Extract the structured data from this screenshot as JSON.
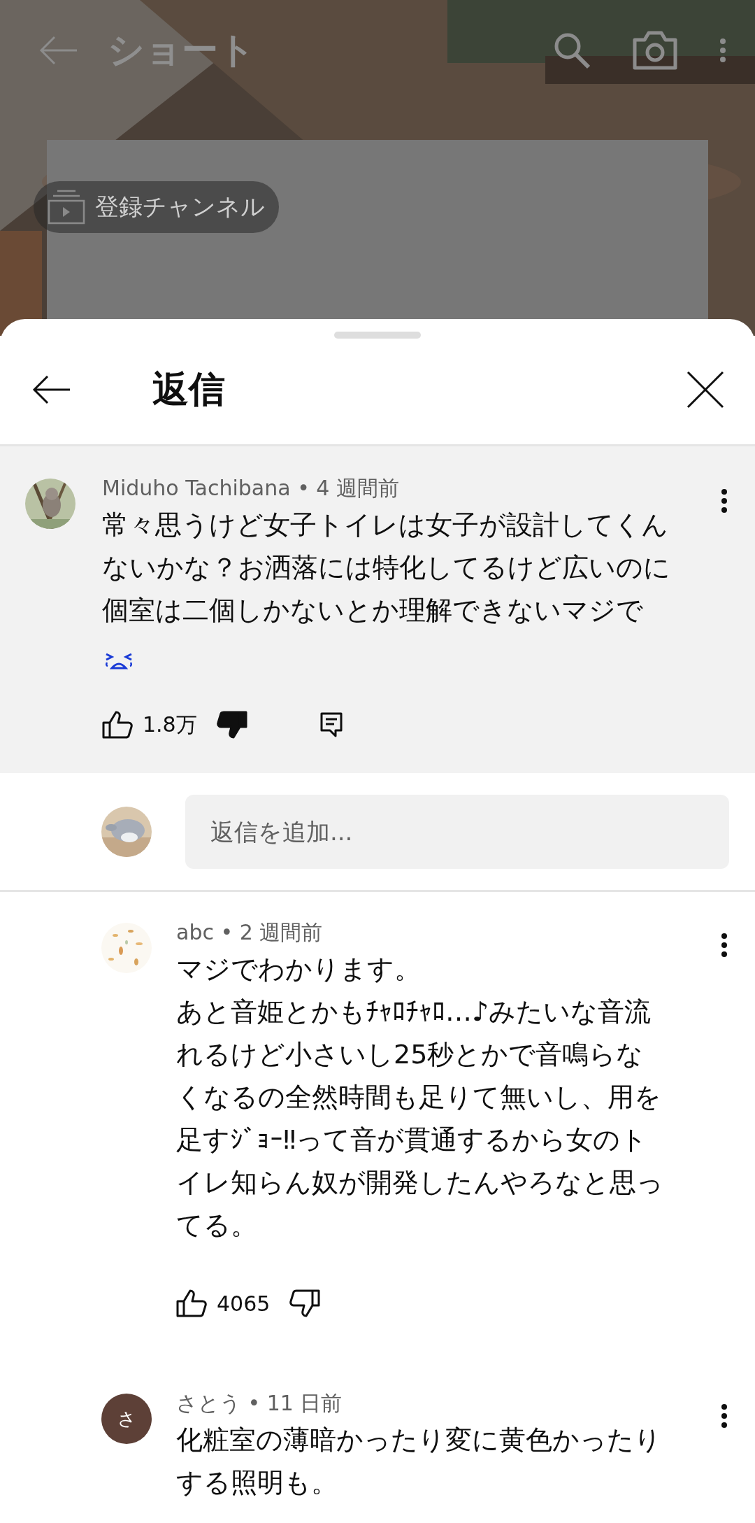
{
  "header": {
    "title": "ショート"
  },
  "background": {
    "kind": "picture"
  },
  "subscriptions_chip": {
    "label": "登録チャンネル"
  },
  "sheet": {
    "title": "返信"
  },
  "parent_comment": {
    "avatar": {
      "kind": "picture"
    },
    "meta": "Miduho Tachibana • 4 週間前",
    "paragraphs": [
      "常々思うけど女子トイレは女子が設計してくんないかな？お洒落には特化してるけど広いのに個室は二個しかないとか理解できないマジで"
    ],
    "emoji": true,
    "likes": "1.8万",
    "liked": false,
    "disliked": true,
    "reply_button": true
  },
  "reply_box": {
    "avatar": {
      "kind": "picture"
    },
    "placeholder": "返信を追加..."
  },
  "replies": [
    {
      "avatar": {
        "kind": "picture"
      },
      "meta": "abc • 2 週間前",
      "paragraphs": [
        "マジでわかります。",
        "あと音姫とかもﾁｬﾛﾁｬﾛ…♪みたいな音流れるけど小さいし25秒とかで音鳴らなくなるの全然時間も足りて無いし、用を足すｼﾞｮｰ‼って音が貫通するから女のトイレ知らん奴が開発したんやろなと思ってる。"
      ],
      "likes": "4065",
      "liked": false,
      "disliked": false
    },
    {
      "avatar": {
        "kind": "letter",
        "letter": "さ"
      },
      "meta": "さとう • 11 日前",
      "paragraphs": [
        "化粧室の薄暗かったり変に黄色かったりする照明も。"
      ]
    }
  ]
}
